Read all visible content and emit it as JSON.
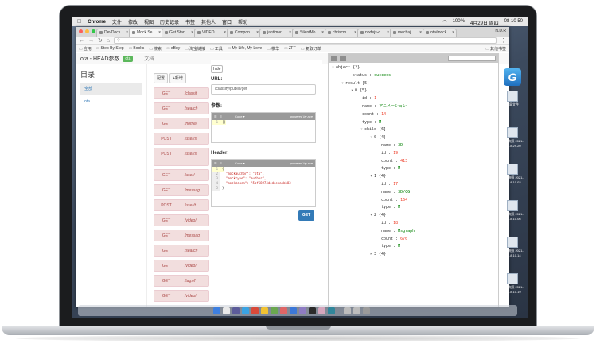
{
  "menubar": {
    "apple": "",
    "items": [
      "Chrome",
      "文件",
      "修改",
      "视图",
      "历史记录",
      "书签",
      "其他人",
      "窗口",
      "帮助"
    ],
    "status": [
      "100%",
      "周四",
      "4月29日 周四",
      "08 10 50"
    ]
  },
  "browser": {
    "tabs": [
      "DevDocs",
      "Mock Se",
      "Get Start",
      "VIDEO",
      "Compon",
      "jantimor",
      "SilentMo",
      "chriscm",
      "nodejs-c",
      "mechaji",
      "ota/mock"
    ],
    "user": "N.D.R",
    "url": "",
    "bookmarks": [
      "应用",
      "Step By Step",
      "Books",
      "搜索",
      "eBuy",
      "淘宝链接",
      "工具",
      "My Life, My Love",
      "横华",
      "ZFF",
      "复取订单",
      "其他书签"
    ]
  },
  "app": {
    "title": "ota - HEAD参数",
    "badge": "ota",
    "doc_link": "文档",
    "sidebar_title": "目录",
    "sidebar_items": [
      "全部",
      "ota"
    ],
    "list_buttons": {
      "config": "配置",
      "add": "+新增"
    },
    "apis": [
      {
        "method": "GET",
        "path": "/classif"
      },
      {
        "method": "GET",
        "path": "/search"
      },
      {
        "method": "GET",
        "path": "/home/"
      },
      {
        "method": "POST",
        "path": "/user/s"
      },
      {
        "method": "POST",
        "path": "/user/s"
      },
      {
        "method": "GET",
        "path": "/user/"
      },
      {
        "method": "GET",
        "path": "/messag"
      },
      {
        "method": "POST",
        "path": "/user/t"
      },
      {
        "method": "GET",
        "path": "/video/"
      },
      {
        "method": "GET",
        "path": "/messag"
      },
      {
        "method": "GET",
        "path": "/search"
      },
      {
        "method": "GET",
        "path": "/video/"
      },
      {
        "method": "GET",
        "path": "/tags/l"
      },
      {
        "method": "GET",
        "path": "/video/"
      }
    ],
    "editor": {
      "hide_label": "hide",
      "url_label": "URL:",
      "url_value": "/classify/public/get",
      "params_label": "参数:",
      "params_code": [
        "{}"
      ],
      "header_label": "Header:",
      "header_code": [
        "{",
        "  \"mockauthor\": \"ota\",",
        "  \"mocktype\": \"author\",",
        "  \"mocktoken\": \"5bf58974dedeedabbb83",
        "}"
      ],
      "code_tab": "Code ▾",
      "powered_by": "powered by ace",
      "send_button": "GET"
    },
    "json": {
      "filter_placeholder": "",
      "rows": [
        {
          "indent": 0,
          "tog": "▾",
          "key": "object",
          "val": "{2}",
          "vt": "k"
        },
        {
          "indent": 2,
          "tog": "",
          "key": "status",
          "val": "success",
          "vt": "s"
        },
        {
          "indent": 1,
          "tog": "▾",
          "key": "result",
          "val": "[5]",
          "vt": "k"
        },
        {
          "indent": 2,
          "tog": "▾",
          "key": "0",
          "val": "{5}",
          "vt": "k"
        },
        {
          "indent": 3,
          "tog": "",
          "key": "id",
          "val": "1",
          "vt": "n"
        },
        {
          "indent": 3,
          "tog": "",
          "key": "name",
          "val": "アニメーション",
          "vt": "s"
        },
        {
          "indent": 3,
          "tog": "",
          "key": "count",
          "val": "14",
          "vt": "n"
        },
        {
          "indent": 3,
          "tog": "",
          "key": "type",
          "val": "M",
          "vt": "s"
        },
        {
          "indent": 3,
          "tog": "▾",
          "key": "child",
          "val": "[6]",
          "vt": "k"
        },
        {
          "indent": 4,
          "tog": "▾",
          "key": "0",
          "val": "{4}",
          "vt": "k"
        },
        {
          "indent": 5,
          "tog": "",
          "key": "name",
          "val": "3D",
          "vt": "s"
        },
        {
          "indent": 5,
          "tog": "",
          "key": "id",
          "val": "19",
          "vt": "n"
        },
        {
          "indent": 5,
          "tog": "",
          "key": "count",
          "val": "413",
          "vt": "n"
        },
        {
          "indent": 5,
          "tog": "",
          "key": "type",
          "val": "M",
          "vt": "s"
        },
        {
          "indent": 4,
          "tog": "▾",
          "key": "1",
          "val": "{4}",
          "vt": "k"
        },
        {
          "indent": 5,
          "tog": "",
          "key": "id",
          "val": "17",
          "vt": "n"
        },
        {
          "indent": 5,
          "tog": "",
          "key": "name",
          "val": "3D/CG",
          "vt": "s"
        },
        {
          "indent": 5,
          "tog": "",
          "key": "count",
          "val": "164",
          "vt": "n"
        },
        {
          "indent": 5,
          "tog": "",
          "key": "type",
          "val": "M",
          "vt": "s"
        },
        {
          "indent": 4,
          "tog": "▾",
          "key": "2",
          "val": "{4}",
          "vt": "k"
        },
        {
          "indent": 5,
          "tog": "",
          "key": "id",
          "val": "18",
          "vt": "n"
        },
        {
          "indent": 5,
          "tog": "",
          "key": "name",
          "val": "Msgraph",
          "vt": "s"
        },
        {
          "indent": 5,
          "tog": "",
          "key": "count",
          "val": "676",
          "vt": "n"
        },
        {
          "indent": 5,
          "tog": "",
          "key": "type",
          "val": "M",
          "vt": "s"
        },
        {
          "indent": 4,
          "tog": "▸",
          "key": "3",
          "val": "{4}",
          "vt": "k"
        }
      ]
    }
  },
  "desktop": {
    "icons": [
      "截屏文件",
      "屏幕快照 2021-04...8.29.20",
      "屏幕快照 2021-04...8.10.03",
      "屏幕快照 2021-04...8.10.06",
      "屏幕快照 2021-04...8.10.14",
      "屏幕快照 2021-04...8.10.19"
    ]
  },
  "colors": {
    "get_button": "#337ab7",
    "badge": "#5cb85c",
    "api_row_bg": "#f2dede"
  }
}
